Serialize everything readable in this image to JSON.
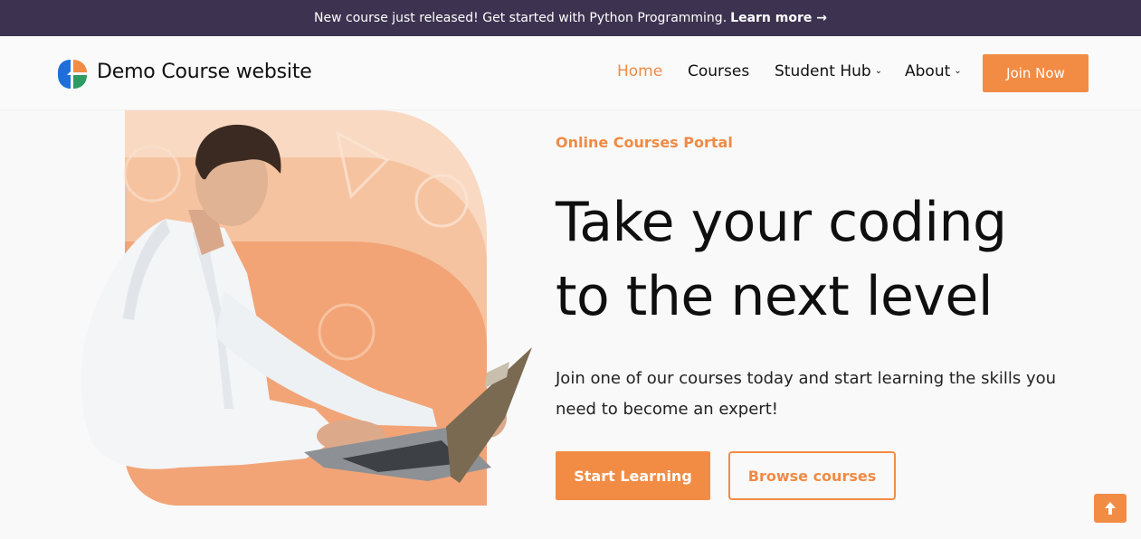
{
  "announcement": {
    "text": "New course just released! Get started with Python Programming.",
    "link_label": "Learn more →"
  },
  "header": {
    "site_name": "Demo Course website",
    "nav": [
      {
        "label": "Home",
        "active": true,
        "dropdown": false
      },
      {
        "label": "Courses",
        "active": false,
        "dropdown": false
      },
      {
        "label": "Student Hub",
        "active": false,
        "dropdown": true
      },
      {
        "label": "About",
        "active": false,
        "dropdown": true
      }
    ],
    "cta_label": "Join Now"
  },
  "hero": {
    "eyebrow": "Online Courses Portal",
    "headline_line1": "Take your coding",
    "headline_line2": "to the next level",
    "subtext": "Join one of our courses today and start learning the skills you need to become an expert!",
    "primary_button": "Start Learning",
    "secondary_button": "Browse courses"
  },
  "icons": {
    "chevron": "chevron-down-icon",
    "scroll_top": "arrow-up-icon",
    "logo": "logo-icon"
  },
  "colors": {
    "accent": "#f28c45",
    "announcement_bg": "#3d3350",
    "background": "#f9f9f9"
  }
}
